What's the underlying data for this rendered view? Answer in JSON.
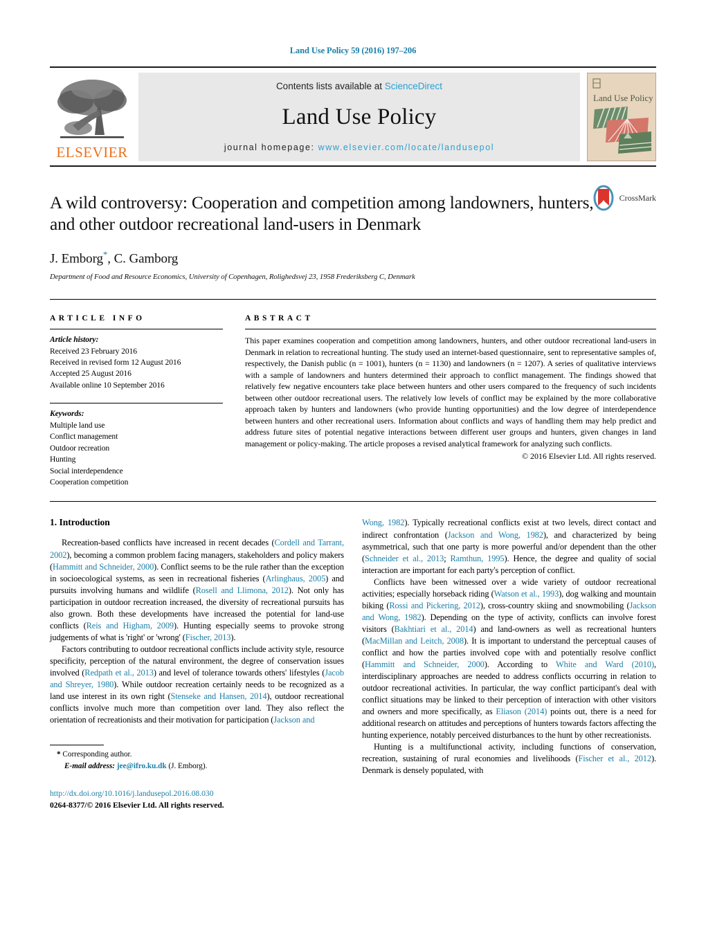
{
  "running_head": "Land Use Policy 59 (2016) 197–206",
  "masthead": {
    "publisher_logo_name": "elsevier-tree-logo",
    "publisher_wordmark": "ELSEVIER",
    "contents_prefix": "Contents lists available at ",
    "contents_link": "ScienceDirect",
    "journal_title": "Land Use Policy",
    "homepage_prefix": "journal homepage: ",
    "homepage_url": "www.elsevier.com/locate/landusepol",
    "cover_title": "Land Use Policy"
  },
  "title": {
    "line1": "A wild controversy: Cooperation and competition among landowners,",
    "line2": "hunters, and other outdoor recreational land-users in Denmark",
    "full": "A wild controversy: Cooperation and competition among landowners, hunters, and other outdoor recreational land-users in Denmark",
    "crossmark_label": "CrossMark"
  },
  "authors": {
    "names": "J. Emborg",
    "corresponding_marker": "*",
    "names_rest": ", C. Gamborg",
    "affiliation": "Department of Food and Resource Economics, University of Copenhagen, Rolighedsvej 23, 1958 Frederiksberg C, Denmark"
  },
  "article_info": {
    "heading": "ARTICLE INFO",
    "history_label": "Article history:",
    "history": [
      "Received 23 February 2016",
      "Received in revised form 12 August 2016",
      "Accepted 25 August 2016",
      "Available online 10 September 2016"
    ],
    "keywords_label": "Keywords:",
    "keywords": [
      "Multiple land use",
      "Conflict management",
      "Outdoor recreation",
      "Hunting",
      "Social interdependence",
      "Cooperation competition"
    ]
  },
  "abstract": {
    "heading": "ABSTRACT",
    "text": "This paper examines cooperation and competition among landowners, hunters, and other outdoor recreational land-users in Denmark in relation to recreational hunting. The study used an internet-based questionnaire, sent to representative samples of, respectively, the Danish public (n = 1001), hunters (n = 1130) and landowners (n = 1207). A series of qualitative interviews with a sample of landowners and hunters determined their approach to conflict management. The findings showed that relatively few negative encounters take place between hunters and other users compared to the frequency of such incidents between other outdoor recreational users. The relatively low levels of conflict may be explained by the more collaborative approach taken by hunters and landowners (who provide hunting opportunities) and the low degree of interdependence between hunters and other recreational users. Information about conflicts and ways of handling them may help predict and address future sites of potential negative interactions between different user groups and hunters, given changes in land management or policy-making. The article proposes a revised analytical framework for analyzing such conflicts.",
    "copyright": "© 2016 Elsevier Ltd. All rights reserved."
  },
  "body": {
    "section_number_title": "1. Introduction",
    "left_paragraph_1": "Recreation-based conflicts have increased in recent decades (Cordell and Tarrant, 2002), becoming a common problem facing managers, stakeholders and policy makers (Hammitt and Schneider, 2000). Conflict seems to be the rule rather than the exception in socioecological systems, as seen in recreational fisheries (Arlinghaus, 2005) and pursuits involving humans and wildlife (Rosell and Llimona, 2012). Not only has participation in outdoor recreation increased, the diversity of recreational pursuits has also grown. Both these developments have increased the potential for land-use conflicts (Reis and Higham, 2009). Hunting especially seems to provoke strong judgements of what is 'right' or 'wrong' (Fischer, 2013).",
    "left_paragraph_2": "Factors contributing to outdoor recreational conflicts include activity style, resource specificity, perception of the natural environment, the degree of conservation issues involved (Redpath et al., 2013) and level of tolerance towards others' lifestyles (Jacob and Shreyer, 1980). While outdoor recreation certainly needs to be recognized as a land use interest in its own right (Stenseke and Hansen, 2014), outdoor recreational conflicts involve much more than competition over land. They also reflect the orientation of recreationists and their motivation for participation (Jackson and",
    "right_paragraph_1": "Wong, 1982). Typically recreational conflicts exist at two levels, direct contact and indirect confrontation (Jackson and Wong, 1982), and characterized by being asymmetrical, such that one party is more powerful and/or dependent than the other (Schneider et al., 2013; Ramthun, 1995). Hence, the degree and quality of social interaction are important for each party's perception of conflict.",
    "right_paragraph_2": "Conflicts have been witnessed over a wide variety of outdoor recreational activities; especially horseback riding (Watson et al., 1993), dog walking and mountain biking (Rossi and Pickering, 2012), cross-country skiing and snowmobiling (Jackson and Wong, 1982). Depending on the type of activity, conflicts can involve forest visitors (Bakhtiari et al., 2014) and land-owners as well as recreational hunters (MacMillan and Leitch, 2008). It is important to understand the perceptual causes of conflict and how the parties involved cope with and potentially resolve conflict (Hammitt and Schneider, 2000). According to White and Ward (2010), interdisciplinary approaches are needed to address conflicts occurring in relation to outdoor recreational activities. In particular, the way conflict participant's deal with conflict situations may be linked to their perception of interaction with other visitors and owners and more specifically, as Eliason (2014) points out, there is a need for additional research on attitudes and perceptions of hunters towards factors affecting the hunting experience, notably perceived disturbances to the hunt by other recreationists.",
    "right_paragraph_3": "Hunting is a multifunctional activity, including functions of conservation, recreation, sustaining of rural economies and livelihoods (Fischer et al., 2012). Denmark is densely populated, with"
  },
  "footnote": {
    "star": "*",
    "corresponding": "Corresponding author.",
    "email_label": "E-mail address:",
    "email": "jee@ifro.ku.dk",
    "email_suffix": "(J. Emborg)."
  },
  "footer": {
    "doi": "http://dx.doi.org/10.1016/j.landusepol.2016.08.030",
    "issn_copyright": "0264-8377/© 2016 Elsevier Ltd. All rights reserved."
  },
  "colors": {
    "link": "#1a7fa8",
    "sciencedirect": "#2a9fd0",
    "elsevier_orange": "#E9711C",
    "band_gray": "#e8e8e8",
    "cover_bg": "#e8d5bd"
  }
}
